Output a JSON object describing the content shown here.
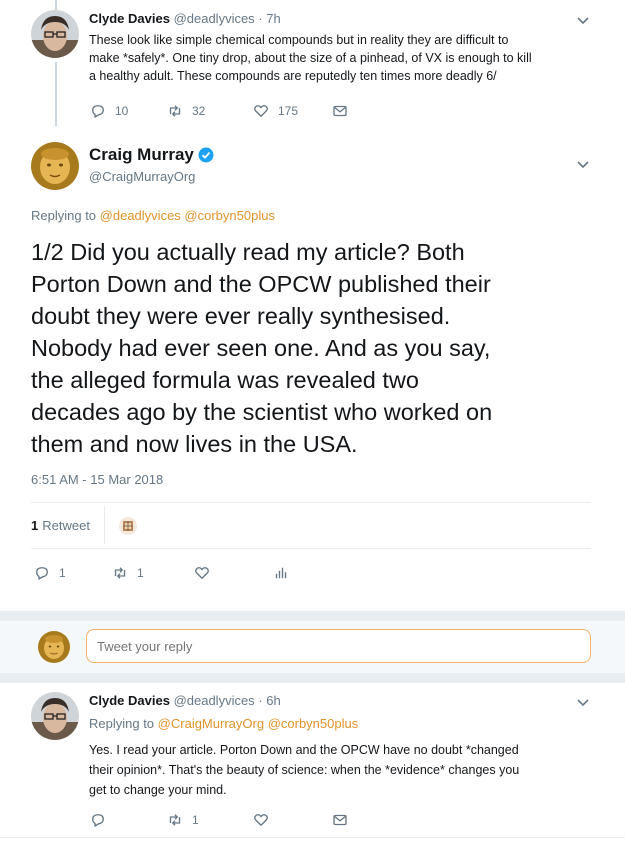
{
  "tweet1": {
    "name": "Clyde Davies",
    "handle": "@deadlyvices",
    "time": "7h",
    "lines": [
      "These look like simple chemical compounds but in reality they are difficult to",
      "make *safely*.  One tiny drop, about the size of a pinhead, of VX is enough to kill",
      "a healthy adult.  These compounds are reputedly ten times more deadly 6/"
    ],
    "reply_count": "10",
    "retweet_count": "32",
    "like_count": "175"
  },
  "main_tweet": {
    "name": "Craig Murray",
    "handle": "@CraigMurrayOrg",
    "replying_label": "Replying to",
    "replying_to": [
      "@deadlyvices",
      "@corbyn50plus"
    ],
    "text_lines": [
      "1/2 Did you actually read my article? Both",
      "Porton Down and the OPCW published their",
      "doubt they were ever really synthesised.",
      "Nobody had ever seen one. And as you say,",
      "the alleged formula was revealed two",
      "decades ago by the scientist who worked on",
      "them and now lives in the USA."
    ],
    "timestamp": "6:51 AM - 15 Mar 2018",
    "retweets_num": "1",
    "retweets_label": "Retweet",
    "reply_count": "1",
    "retweet_count": "1"
  },
  "reply_box": {
    "placeholder": "Tweet your reply"
  },
  "tweet3": {
    "name": "Clyde Davies",
    "handle": "@deadlyvices",
    "time": "6h",
    "replying_label": "Replying to",
    "replying_to": [
      "@CraigMurrayOrg",
      "@corbyn50plus"
    ],
    "lines": [
      "Yes.  I read your article.  Porton Down and the OPCW have no doubt *changed",
      "their opinion*.  That's the beauty of science:  when the *evidence* changes you",
      "get to change your mind."
    ],
    "retweet_count": "1"
  },
  "icons": {
    "reply": "reply-icon",
    "retweet": "retweet-icon",
    "like": "heart-icon",
    "dm": "envelope-icon",
    "analytics": "bar-chart-icon",
    "verified": "verified-badge-icon",
    "caret": "chevron-down-icon"
  },
  "colors": {
    "link_accent": "#e0922b",
    "text_primary": "#14171a",
    "text_secondary": "#657786",
    "verified": "#1da1f2",
    "divider": "#e6ecf0"
  }
}
